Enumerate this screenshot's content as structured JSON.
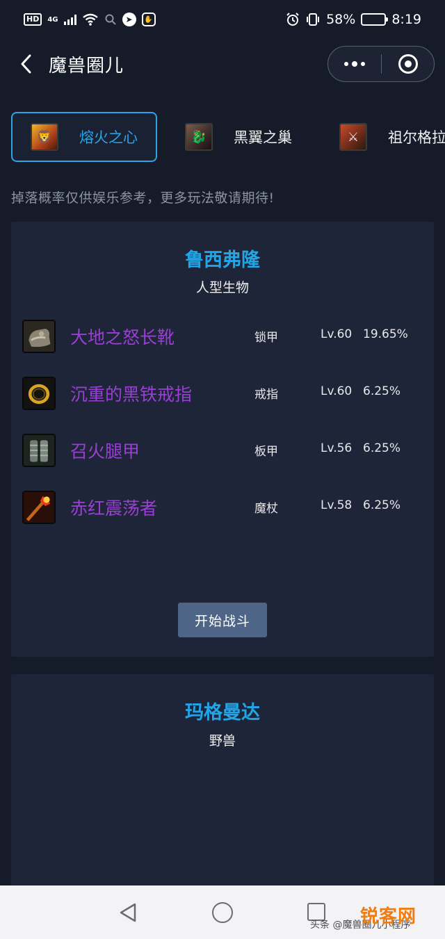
{
  "status_bar": {
    "hd": "HD",
    "network": "4G",
    "battery_percent": "58%",
    "battery_level": 0.58,
    "time": "8:19"
  },
  "nav": {
    "title": "魔兽圈儿"
  },
  "raid_tabs": [
    {
      "label": "熔火之心",
      "icon": "molten-core-icon",
      "active": true
    },
    {
      "label": "黑翼之巢",
      "icon": "blackwing-lair-icon",
      "active": false
    },
    {
      "label": "祖尔格拉",
      "icon": "zulgurub-icon",
      "active": false
    }
  ],
  "notice": "掉落概率仅供娱乐参考，更多玩法敬请期待!",
  "bosses": [
    {
      "name": "鲁西弗隆",
      "type": "人型生物",
      "loot": [
        {
          "name": "大地之怒长靴",
          "slot": "锁甲",
          "level": "Lv.60",
          "rate": "19.65%",
          "icon": "boots-icon"
        },
        {
          "name": "沉重的黑铁戒指",
          "slot": "戒指",
          "level": "Lv.60",
          "rate": "6.25%",
          "icon": "ring-icon"
        },
        {
          "name": "召火腿甲",
          "slot": "板甲",
          "level": "Lv.56",
          "rate": "6.25%",
          "icon": "leg-armor-icon"
        },
        {
          "name": "赤红震荡者",
          "slot": "魔杖",
          "level": "Lv.58",
          "rate": "6.25%",
          "icon": "wand-icon"
        }
      ],
      "action_label": "开始战斗"
    },
    {
      "name": "玛格曼达",
      "type": "野兽"
    }
  ],
  "watermark": {
    "text": "头条 @魔兽圈儿小程序",
    "logo": "锐客网"
  },
  "colors": {
    "background": "#151b29",
    "card": "#1f2538",
    "accent": "#22a4e6",
    "epic_item": "#9a3fd3",
    "button": "#4e6587"
  }
}
